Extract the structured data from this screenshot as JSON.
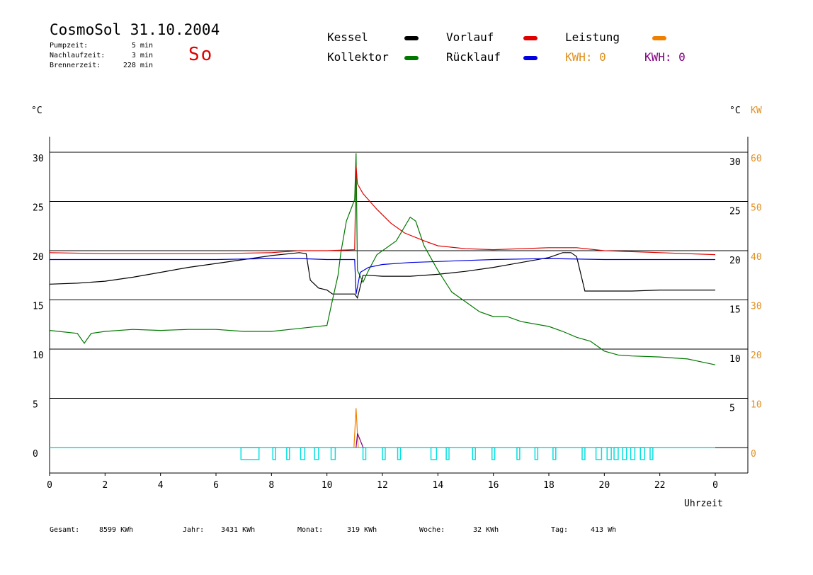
{
  "header": {
    "title": "CosmoSol 31.10.2004",
    "day": "So",
    "stats": [
      {
        "label": "Pumpzeit:",
        "value": "5 min"
      },
      {
        "label": "Nachlaufzeit:",
        "value": "3 min"
      },
      {
        "label": "Brennerzeit:",
        "value": "228 min"
      }
    ]
  },
  "legend": {
    "kessel": "Kessel",
    "kollektor": "Kollektor",
    "vorlauf": "Vorlauf",
    "ruecklauf": "Rücklauf",
    "leistung": "Leistung",
    "kwh_orange": "KWH: 0",
    "kwh_purple": "KWH: 0"
  },
  "colors": {
    "kessel": "#000000",
    "kollektor": "#007800",
    "vorlauf": "#e00000",
    "ruecklauf": "#0000e0",
    "leistung": "#f08000",
    "kwh_purple": "#800080",
    "pump": "#00e0e0"
  },
  "footer": [
    {
      "label": "Gesamt:",
      "value": "8599 KWh"
    },
    {
      "label": "Jahr:",
      "value": "3431 KWh"
    },
    {
      "label": "Monat:",
      "value": "319 KWh"
    },
    {
      "label": "Woche:",
      "value": "32 KWh"
    },
    {
      "label": "Tag:",
      "value": "413 Wh"
    }
  ],
  "chart_data": {
    "type": "line",
    "title": "CosmoSol 31.10.2004",
    "xlabel": "Uhrzeit",
    "ylabel_left": "°C",
    "ylabel_right": "°C",
    "ylabel_right2": "KW",
    "xlim": [
      0,
      24
    ],
    "ylim": [
      0,
      30
    ],
    "x_ticks": [
      "0",
      "2",
      "4",
      "6",
      "8",
      "10",
      "12",
      "14",
      "16",
      "18",
      "20",
      "22",
      "0"
    ],
    "y_ticks_left": [
      "0",
      "5",
      "10",
      "15",
      "20",
      "25",
      "30"
    ],
    "y_ticks_right": [
      "5",
      "10",
      "15",
      "20",
      "25",
      "30"
    ],
    "y_ticks_kw": [
      "0",
      "10",
      "20",
      "30",
      "40",
      "50",
      "60"
    ],
    "grid": true,
    "series": [
      {
        "name": "Kessel",
        "key": "kessel",
        "points": [
          [
            0,
            16.6
          ],
          [
            1,
            16.7
          ],
          [
            2,
            16.9
          ],
          [
            3,
            17.3
          ],
          [
            4,
            17.8
          ],
          [
            5,
            18.3
          ],
          [
            6,
            18.7
          ],
          [
            7,
            19.1
          ],
          [
            8,
            19.5
          ],
          [
            9,
            19.8
          ],
          [
            9.25,
            19.7
          ],
          [
            9.4,
            17.0
          ],
          [
            9.7,
            16.2
          ],
          [
            10,
            16.0
          ],
          [
            10.2,
            15.6
          ],
          [
            11.0,
            15.6
          ],
          [
            11.1,
            15.2
          ],
          [
            11.3,
            17.5
          ],
          [
            11.5,
            17.5
          ],
          [
            12,
            17.4
          ],
          [
            13,
            17.4
          ],
          [
            14,
            17.6
          ],
          [
            15,
            17.9
          ],
          [
            16,
            18.3
          ],
          [
            17,
            18.8
          ],
          [
            18,
            19.3
          ],
          [
            18.5,
            19.8
          ],
          [
            18.8,
            19.8
          ],
          [
            19.0,
            19.4
          ],
          [
            19.3,
            15.9
          ],
          [
            20,
            15.9
          ],
          [
            21,
            15.9
          ],
          [
            22,
            16.0
          ],
          [
            23,
            16.0
          ],
          [
            24,
            16.0
          ]
        ]
      },
      {
        "name": "Kollektor",
        "key": "kollektor",
        "points": [
          [
            0,
            11.9
          ],
          [
            1,
            11.6
          ],
          [
            1.25,
            10.6
          ],
          [
            1.5,
            11.6
          ],
          [
            2,
            11.8
          ],
          [
            3,
            12.0
          ],
          [
            4,
            11.9
          ],
          [
            5,
            12.0
          ],
          [
            6,
            12.0
          ],
          [
            7,
            11.8
          ],
          [
            8,
            11.8
          ],
          [
            9,
            12.1
          ],
          [
            10,
            12.4
          ],
          [
            10.2,
            15.0
          ],
          [
            10.4,
            17.5
          ],
          [
            10.5,
            19.8
          ],
          [
            10.7,
            23.0
          ],
          [
            11.0,
            25.2
          ],
          [
            11.05,
            29.9
          ],
          [
            11.1,
            18.0
          ],
          [
            11.3,
            16.8
          ],
          [
            11.5,
            18.0
          ],
          [
            11.8,
            19.6
          ],
          [
            12.5,
            21.0
          ],
          [
            13.0,
            23.4
          ],
          [
            13.2,
            23.0
          ],
          [
            13.5,
            20.5
          ],
          [
            14.0,
            18.0
          ],
          [
            14.5,
            15.8
          ],
          [
            15.0,
            14.8
          ],
          [
            15.5,
            13.8
          ],
          [
            16.0,
            13.3
          ],
          [
            16.5,
            13.3
          ],
          [
            17.0,
            12.8
          ],
          [
            18.0,
            12.3
          ],
          [
            18.5,
            11.8
          ],
          [
            19.0,
            11.2
          ],
          [
            19.5,
            10.8
          ],
          [
            20.0,
            9.8
          ],
          [
            20.5,
            9.4
          ],
          [
            21.0,
            9.3
          ],
          [
            22.0,
            9.2
          ],
          [
            23.0,
            9.0
          ],
          [
            24,
            8.4
          ]
        ]
      },
      {
        "name": "Vorlauf",
        "key": "vorlauf",
        "points": [
          [
            0,
            19.8
          ],
          [
            2,
            19.7
          ],
          [
            4,
            19.7
          ],
          [
            6,
            19.7
          ],
          [
            8,
            19.8
          ],
          [
            9,
            20.0
          ],
          [
            10,
            20.0
          ],
          [
            11.0,
            20.1
          ],
          [
            11.05,
            28.6
          ],
          [
            11.1,
            26.8
          ],
          [
            11.3,
            25.8
          ],
          [
            11.8,
            24.2
          ],
          [
            12.3,
            22.8
          ],
          [
            12.8,
            21.8
          ],
          [
            13.5,
            21.0
          ],
          [
            14.0,
            20.5
          ],
          [
            15,
            20.2
          ],
          [
            16,
            20.1
          ],
          [
            17,
            20.2
          ],
          [
            18,
            20.3
          ],
          [
            19,
            20.3
          ],
          [
            20,
            20.0
          ],
          [
            22,
            19.8
          ],
          [
            24,
            19.6
          ]
        ]
      },
      {
        "name": "Rücklauf",
        "key": "ruecklauf",
        "points": [
          [
            0,
            19.1
          ],
          [
            2,
            19.1
          ],
          [
            4,
            19.1
          ],
          [
            6,
            19.1
          ],
          [
            8,
            19.2
          ],
          [
            9,
            19.2
          ],
          [
            10,
            19.1
          ],
          [
            11.0,
            19.1
          ],
          [
            11.05,
            15.6
          ],
          [
            11.2,
            17.8
          ],
          [
            11.5,
            18.3
          ],
          [
            12,
            18.6
          ],
          [
            13,
            18.8
          ],
          [
            14,
            18.9
          ],
          [
            16,
            19.1
          ],
          [
            18,
            19.2
          ],
          [
            20,
            19.1
          ],
          [
            22,
            19.1
          ],
          [
            24,
            19.1
          ]
        ]
      }
    ],
    "pump_pulses": [
      [
        6.9,
        7.55
      ],
      [
        8.05,
        8.15
      ],
      [
        8.55,
        8.65
      ],
      [
        9.05,
        9.2
      ],
      [
        9.55,
        9.7
      ],
      [
        10.15,
        10.3
      ],
      [
        11.3,
        11.4
      ],
      [
        12.0,
        12.1
      ],
      [
        12.55,
        12.65
      ],
      [
        13.75,
        13.95
      ],
      [
        14.3,
        14.4
      ],
      [
        15.25,
        15.35
      ],
      [
        15.95,
        16.05
      ],
      [
        16.85,
        16.95
      ],
      [
        17.5,
        17.6
      ],
      [
        18.15,
        18.25
      ],
      [
        19.2,
        19.3
      ],
      [
        19.7,
        19.9
      ],
      [
        20.1,
        20.25
      ],
      [
        20.35,
        20.5
      ],
      [
        20.65,
        20.8
      ],
      [
        20.95,
        21.1
      ],
      [
        21.3,
        21.45
      ],
      [
        21.65,
        21.75
      ]
    ],
    "power_spike": {
      "x": 11.05,
      "peak_kw": 8
    }
  }
}
